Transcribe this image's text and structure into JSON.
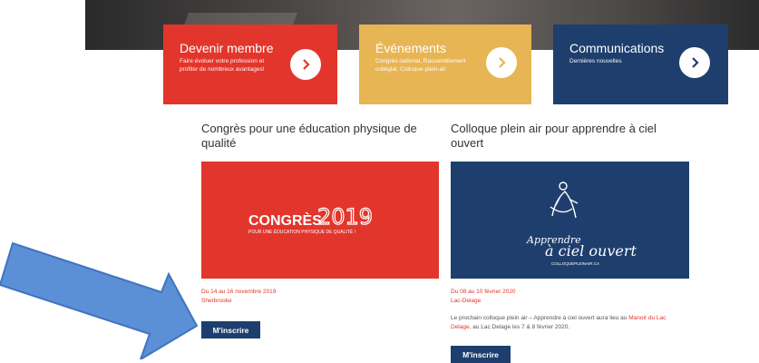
{
  "cards": [
    {
      "title": "Devenir membre",
      "subtitle": "Faire évoluer votre profession et profiter de nombreux avantages!",
      "color": "#e2362c"
    },
    {
      "title": "Événements",
      "subtitle": "Congrès national, Rassemblement collégial, Colloque plein-air",
      "color": "#e8b554"
    },
    {
      "title": "Communications",
      "subtitle": "Dernières nouvelles",
      "color": "#1e3f6e"
    }
  ],
  "articles": [
    {
      "title": "Congrès pour une éducation physique de qualité",
      "image": {
        "brand": "CONGRÈS",
        "year": "2019",
        "tagline": "POUR UNE ÉDUCATION PHYSIQUE DE QUALITÉ !",
        "color": "#e2362c"
      },
      "date": "Du 14 au 16 novembre 2019",
      "location": "Sherbrooke",
      "button": "M'inscrire"
    },
    {
      "title": "Colloque plein air pour apprendre à ciel ouvert",
      "image": {
        "line1": "Apprendre",
        "line2": "à ciel ouvert",
        "footer": "COLLOQUEPLEINAIR.CA",
        "color": "#1e3f6e"
      },
      "date": "Du 08 au 10 février 2020",
      "location": "Lac-Delage",
      "description_before": "Le prochain colloque plein air – Apprendre à ciel ouvert aura lieu au ",
      "description_link": "Manoir du Lac Delage",
      "description_after": ", au Lac Delage les 7 & 8  février 2020.",
      "button": "M'inscrire"
    }
  ],
  "annotation": {
    "color": "#5b8fd6",
    "icon": "arrow-pointer-icon"
  }
}
